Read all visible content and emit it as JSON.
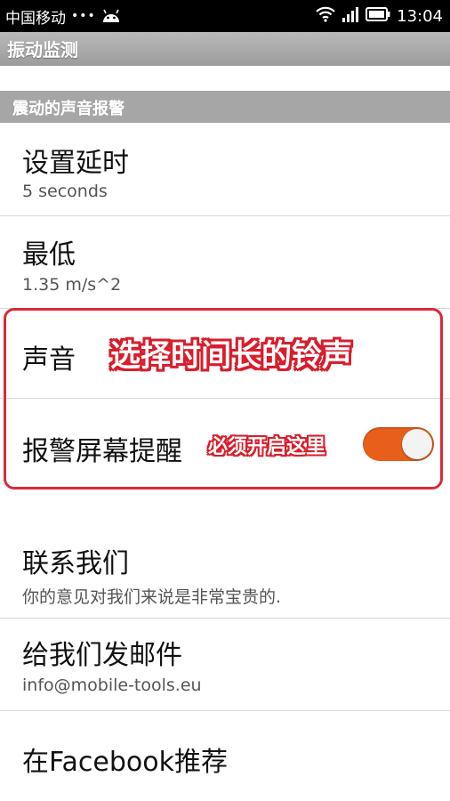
{
  "status_bar": {
    "carrier": "中国移动",
    "dots": "•••",
    "time": "13:04",
    "icons": [
      "android-icon",
      "wifi-icon",
      "signal-icon",
      "battery-icon"
    ]
  },
  "title_bar": {
    "title": "振动监测"
  },
  "section": {
    "header": "震动的声音报警"
  },
  "prefs": {
    "delay": {
      "title": "设置延时",
      "summary": "5 seconds"
    },
    "minimum": {
      "title": "最低",
      "summary": "1.35 m/s^2"
    },
    "sound": {
      "title": "声音"
    },
    "screen_alarm": {
      "title": "报警屏幕提醒",
      "enabled": true
    },
    "contact": {
      "title": "联系我们",
      "summary": "你的意见对我们来说是非常宝贵的."
    },
    "email": {
      "title": "给我们发邮件",
      "summary": "info@mobile-tools.eu"
    },
    "facebook": {
      "title": "在Facebook推荐"
    }
  },
  "annotations": {
    "sound_hint": "选择时间长的铃声",
    "toggle_hint": "必须开启这里",
    "color": "#d81e2c"
  },
  "colors": {
    "toggle_on": "#e85f1c",
    "section_header_bg": "#a6a6a6",
    "titlebar_bg": "#a8a8a8"
  }
}
